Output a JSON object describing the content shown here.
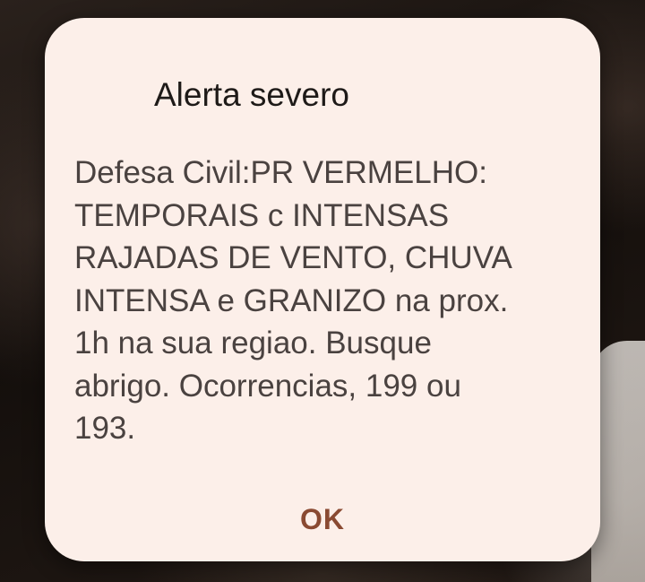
{
  "alert": {
    "title": "Alerta severo",
    "message": "Defesa Civil:PR VERMELHO:\nTEMPORAIS c INTENSAS\nRAJADAS DE VENTO, CHUVA\nINTENSA e GRANIZO na prox.\n1h na sua regiao. Busque\nabrigo. Ocorrencias, 199 ou\n193.",
    "ok_label": "OK"
  },
  "colors": {
    "dialog_background": "#fcefe9",
    "title_text": "#1e1a18",
    "message_text": "#4a4240",
    "button_text": "#8a4a32"
  }
}
